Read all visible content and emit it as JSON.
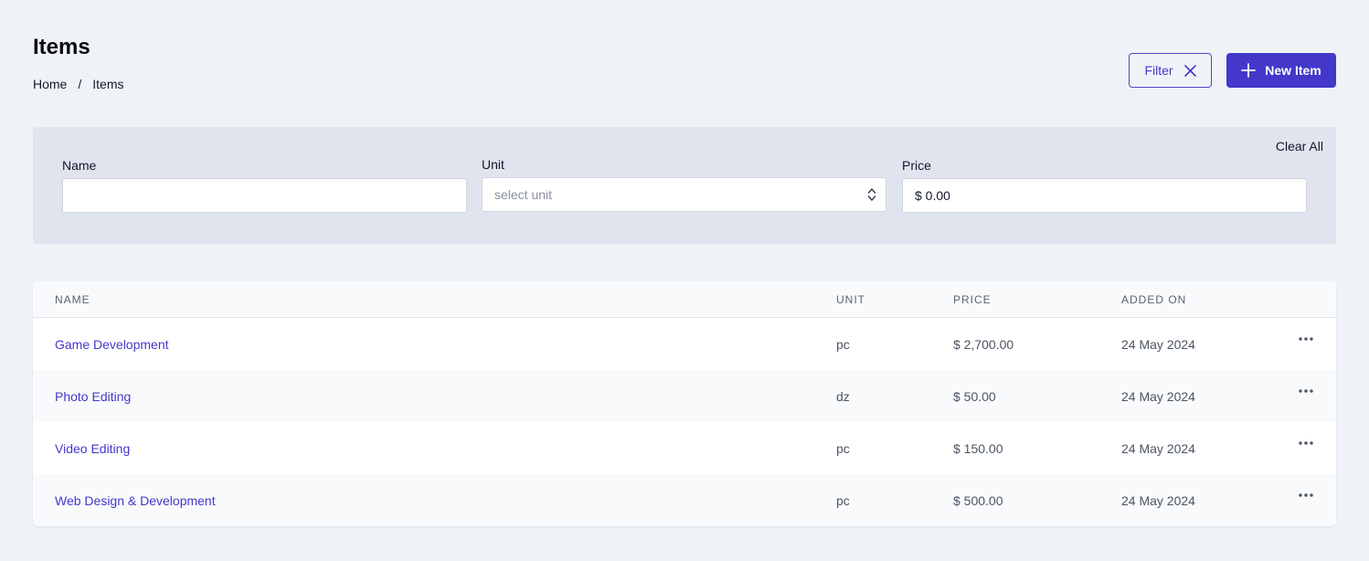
{
  "header": {
    "title": "Items",
    "breadcrumb": [
      "Home",
      "/",
      "Items"
    ],
    "filter_label": "Filter",
    "new_item_label": "New Item"
  },
  "filters": {
    "clear_all": "Clear All",
    "name_label": "Name",
    "name_value": "",
    "unit_label": "Unit",
    "unit_placeholder": "select unit",
    "price_label": "Price",
    "price_value": "$ 0.00"
  },
  "table": {
    "columns": [
      "Name",
      "Unit",
      "Price",
      "Added On"
    ],
    "rows": [
      {
        "name": "Game Development",
        "unit": "pc",
        "price": "$ 2,700.00",
        "added_on": "24 May 2024"
      },
      {
        "name": "Photo Editing",
        "unit": "dz",
        "price": "$ 50.00",
        "added_on": "24 May 2024"
      },
      {
        "name": "Video Editing",
        "unit": "pc",
        "price": "$ 150.00",
        "added_on": "24 May 2024"
      },
      {
        "name": "Web Design & Development",
        "unit": "pc",
        "price": "$ 500.00",
        "added_on": "24 May 2024"
      }
    ]
  },
  "colors": {
    "accent": "#4338ca",
    "background": "#eff3f8",
    "filter_panel": "#dfe4ee"
  }
}
